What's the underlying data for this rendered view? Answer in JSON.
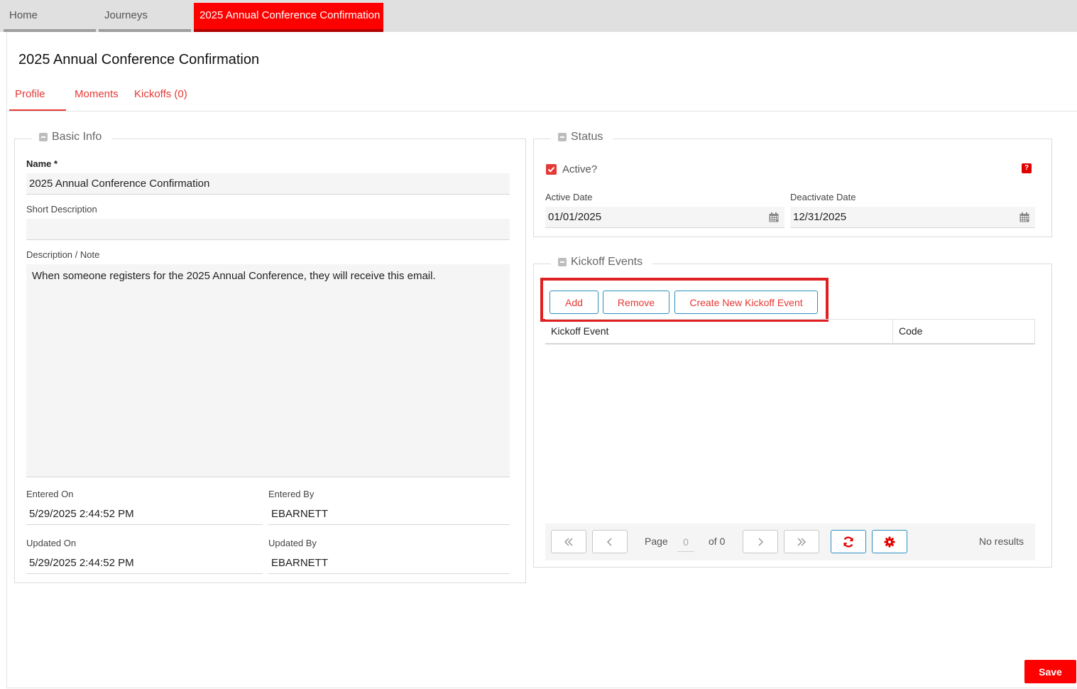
{
  "top_tabs": [
    {
      "label": "Home"
    },
    {
      "label": "Journeys"
    },
    {
      "label": "2025 Annual Conference Confirmation"
    }
  ],
  "page_title": "2025 Annual Conference Confirmation",
  "sub_tabs": [
    {
      "label": "Profile",
      "active": true
    },
    {
      "label": "Moments"
    },
    {
      "label": "Kickoffs (0)"
    }
  ],
  "basic_info": {
    "legend": "Basic Info",
    "name_label": "Name *",
    "name_value": "2025 Annual Conference Confirmation",
    "short_desc_label": "Short Description",
    "short_desc_value": "",
    "desc_label": "Description / Note",
    "desc_value": "When someone registers for the 2025 Annual Conference, they will receive this email.",
    "entered_on_label": "Entered On",
    "entered_on_value": "5/29/2025 2:44:52 PM",
    "entered_by_label": "Entered By",
    "entered_by_value": "EBARNETT",
    "updated_on_label": "Updated On",
    "updated_on_value": "5/29/2025 2:44:52 PM",
    "updated_by_label": "Updated By",
    "updated_by_value": "EBARNETT"
  },
  "status": {
    "legend": "Status",
    "active_label": "Active?",
    "active_checked": true,
    "help_label": "?",
    "active_date_label": "Active Date",
    "active_date_value": "01/01/2025",
    "deactivate_date_label": "Deactivate Date",
    "deactivate_date_value": "12/31/2025"
  },
  "kickoff_events": {
    "legend": "Kickoff Events",
    "add_label": "Add",
    "remove_label": "Remove",
    "create_label": "Create New Kickoff Event",
    "columns": [
      "Kickoff Event",
      "Code"
    ],
    "pager": {
      "page_label": "Page",
      "page_value": "0",
      "of_label": "of 0",
      "results_label": "No results"
    }
  },
  "save_label": "Save",
  "colors": {
    "accent": "#ff0000",
    "link": "#e53935",
    "button_border": "#2b8fbd"
  }
}
